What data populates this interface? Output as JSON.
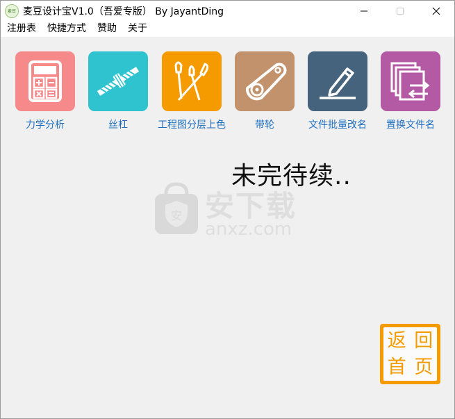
{
  "window": {
    "title": "麦豆设计宝V1.0（吾爱专版）  By JayantDing",
    "icon_label": "麦豆"
  },
  "menu": {
    "items": [
      "注册表",
      "快捷方式",
      "赞助",
      "关于"
    ]
  },
  "tools": [
    {
      "label": "力学分析",
      "color": "#f68a8a",
      "icon": "calculator-icon"
    },
    {
      "label": "丝杠",
      "color": "#2fc3cf",
      "icon": "screw-icon"
    },
    {
      "label": "工程图分层上色",
      "color": "#f59b00",
      "icon": "brushes-icon"
    },
    {
      "label": "带轮",
      "color": "#c2926c",
      "icon": "belt-pulley-icon"
    },
    {
      "label": "文件批量改名",
      "color": "#46637d",
      "icon": "pencil-icon"
    },
    {
      "label": "置换文件名",
      "color": "#b45aa4",
      "icon": "file-swap-icon"
    }
  ],
  "main": {
    "status_text": "未完待续.."
  },
  "watermark": {
    "text": "安下载",
    "sub": "anxz.com",
    "badge": "安"
  },
  "home_button": {
    "chars": [
      "返",
      "回",
      "首",
      "页"
    ],
    "color": "#f59b00"
  }
}
